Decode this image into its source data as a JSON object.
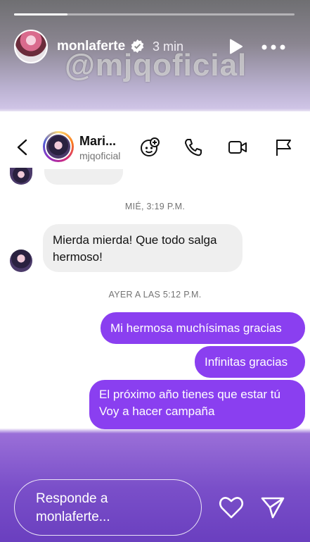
{
  "story": {
    "progress": 0.19,
    "username": "monlaferte",
    "time": "3 min",
    "watermark": "@mjqoficial"
  },
  "dm": {
    "contact_name": "Mari...",
    "contact_handle": "mjqoficial",
    "icons": [
      "back-icon",
      "avatar-add-icon",
      "phone-icon",
      "video-icon",
      "flag-icon"
    ]
  },
  "chat": {
    "timestamp_1": "MIÉ, 3:19 P.M.",
    "incoming_message": "Mierda mierda! Que todo salga hermoso!",
    "timestamp_2": "AYER A LAS 5:12 P.M.",
    "outgoing": [
      {
        "text": "Mi hermosa muchísimas gracias"
      },
      {
        "text": "Infinitas gracias"
      },
      {
        "text_line1": "El próximo año tienes que estar tú",
        "text_line2": "Voy a hacer campaña"
      }
    ]
  },
  "reply": {
    "placeholder": "Responde a monlaferte..."
  },
  "colors": {
    "outgoing_bubble": "#8a3ff0",
    "incoming_bubble": "#efefef"
  }
}
